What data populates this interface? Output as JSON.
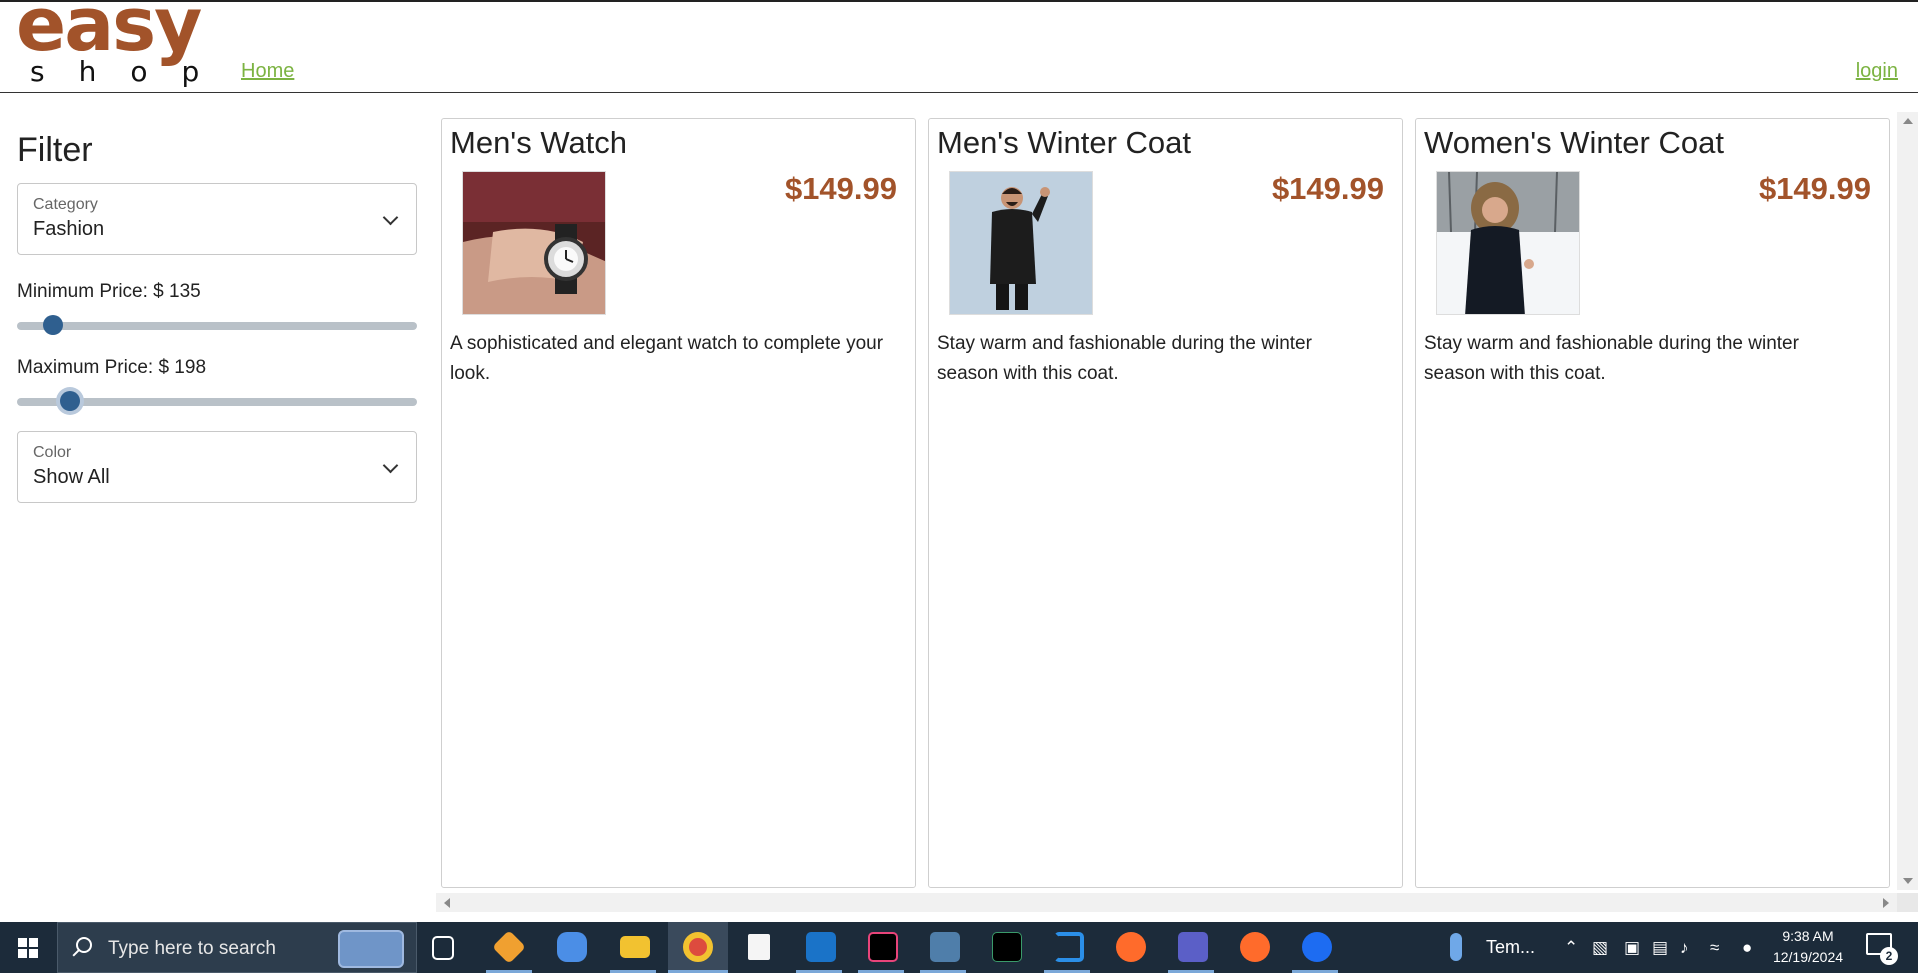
{
  "header": {
    "logo_top": "easy",
    "logo_bottom": "shop",
    "nav_home": "Home",
    "nav_login": "login",
    "logo_color": "#a2532a",
    "link_color": "#7cb342"
  },
  "filter": {
    "title": "Filter",
    "category": {
      "label": "Category",
      "value": "Fashion"
    },
    "min_price": {
      "label": "Minimum Price: $ 135",
      "value": 135,
      "range_max": 1500
    },
    "max_price": {
      "label": "Maximum Price: $ 198",
      "value": 198,
      "range_max": 1500
    },
    "color": {
      "label": "Color",
      "value": "Show All"
    }
  },
  "products": [
    {
      "name": "Men's Watch",
      "price": "$149.99",
      "description": "A sophisticated and elegant watch to complete your look.",
      "image": "watch-photo"
    },
    {
      "name": "Men's Winter Coat",
      "price": "$149.99",
      "description": "Stay warm and fashionable during the winter season with this coat.",
      "image": "mens-coat-photo"
    },
    {
      "name": "Women's Winter Coat",
      "price": "$149.99",
      "description": "Stay warm and fashionable during the winter season with this coat.",
      "image": "womens-coat-photo"
    }
  ],
  "taskbar": {
    "search_placeholder": "Type here to search",
    "weather_label": "Tem...",
    "time": "9:38 AM",
    "date": "12/19/2024",
    "notification_count": "2"
  }
}
